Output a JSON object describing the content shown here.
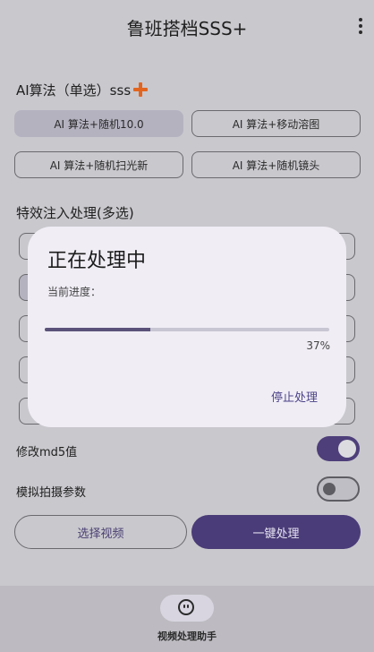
{
  "app": {
    "title": "鲁班搭档SSS+"
  },
  "ai_section": {
    "title": "AI算法（单选）sss",
    "options": [
      "AI 算法+随机10.0",
      "AI 算法+移动溶图",
      "AI 算法+随机扫光新",
      "AI 算法+随机镜头"
    ]
  },
  "effects_section": {
    "title": "特效注入处理(多选)"
  },
  "toggles": [
    {
      "label": "修改md5值",
      "state": "on"
    },
    {
      "label": "模拟拍摄参数",
      "state": "off"
    }
  ],
  "actions": {
    "select_video": "选择视频",
    "one_click": "一键处理"
  },
  "bottom_nav": {
    "label": "视频处理助手"
  },
  "dialog": {
    "title": "正在处理中",
    "subtitle": "当前进度：",
    "progress_percent": 37,
    "progress_text": "37%",
    "stop_label": "停止处理"
  },
  "colors": {
    "accent": "#4a3c78",
    "orange": "#e2651f"
  }
}
